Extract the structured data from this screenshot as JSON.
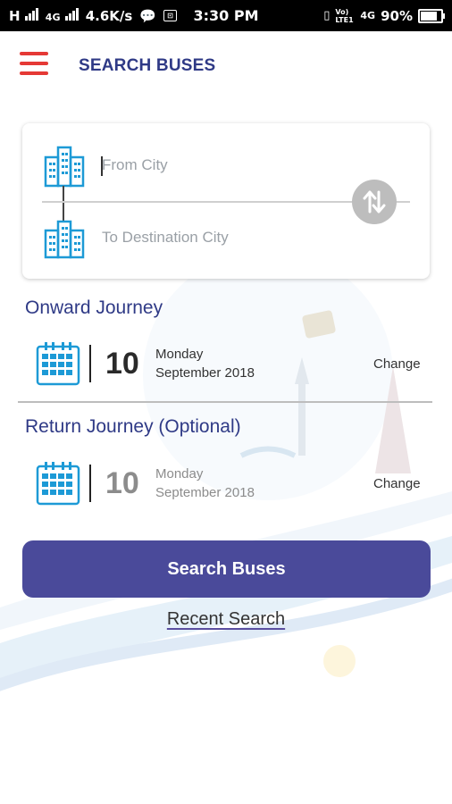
{
  "status_bar": {
    "carrier_left": "H",
    "net_type": "4G",
    "speed": "4.6K/s",
    "time": "3:30 PM",
    "volte": "Vo) LTE1",
    "net_type_right": "4G",
    "battery": "90%",
    "battery_level": 0.9
  },
  "header": {
    "title": "SEARCH BUSES",
    "menu_icon": "hamburger-menu-icon",
    "accent_color": "#e53935",
    "title_color": "#2f3a86"
  },
  "route": {
    "from_placeholder": "From City",
    "to_placeholder": "To Destination City",
    "swap_icon": "swap-vertical-icon",
    "city_icon": "buildings-icon"
  },
  "onward": {
    "title": "Onward Journey",
    "day": "10",
    "weekday": "Monday",
    "month_year": "September 2018",
    "change_label": "Change"
  },
  "return_trip": {
    "title": "Return Journey (Optional)",
    "day": "10",
    "weekday": "Monday",
    "month_year": "September 2018",
    "change_label": "Change"
  },
  "actions": {
    "search_label": "Search Buses",
    "recent_label": "Recent Search",
    "button_color": "#4a4a9a"
  }
}
